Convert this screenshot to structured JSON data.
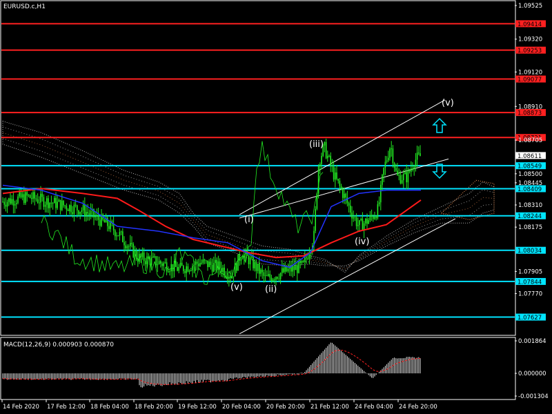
{
  "chart_data": {
    "type": "line",
    "title": "EURUSD.c,H1",
    "symbol": "EURUSD.c",
    "timeframe": "H1",
    "ylim": [
      1.0752,
      1.0955
    ],
    "y_ticks": [
      "1.09525",
      "1.09320",
      "1.09120",
      "1.08910",
      "1.08705",
      "1.08500",
      "1.08445",
      "1.08310",
      "1.08175",
      "1.07905",
      "1.07770"
    ],
    "x_ticks": [
      "14 Feb 2020",
      "17 Feb 12:00",
      "18 Feb 04:00",
      "18 Feb 20:00",
      "19 Feb 12:00",
      "20 Feb 04:00",
      "20 Feb 20:00",
      "21 Feb 12:00",
      "24 Feb 04:00",
      "24 Feb 20:00"
    ],
    "current_price": "1.08611",
    "resistance_levels": [
      {
        "label": "1.09414",
        "value": 1.09414,
        "color": "#ff2020"
      },
      {
        "label": "1.09253",
        "value": 1.09253,
        "color": "#ff2020"
      },
      {
        "label": "1.09077",
        "value": 1.09077,
        "color": "#ff2020"
      },
      {
        "label": "1.08873",
        "value": 1.08873,
        "color": "#ff2020"
      },
      {
        "label": "1.08721",
        "value": 1.08721,
        "color": "#ff2020"
      }
    ],
    "support_levels": [
      {
        "label": "1.08549",
        "value": 1.08549,
        "color": "#00e5ff"
      },
      {
        "label": "1.08409",
        "value": 1.08409,
        "color": "#00e5ff"
      },
      {
        "label": "1.08244",
        "value": 1.08244,
        "color": "#00e5ff"
      },
      {
        "label": "1.08034",
        "value": 1.08034,
        "color": "#00e5ff"
      },
      {
        "label": "1.07844",
        "value": 1.07844,
        "color": "#00e5ff"
      },
      {
        "label": "1.07627",
        "value": 1.07627,
        "color": "#00e5ff"
      }
    ],
    "wave_labels": [
      "(v)",
      "(i)",
      "(ii)",
      "(iii)",
      "(iv)",
      "(v)"
    ],
    "macd": {
      "label": "MACD(12,26,9) 0.000903 0.000870",
      "ylim": [
        -0.001304,
        0.001864
      ],
      "y_ticks": [
        "0.001864",
        "0.000000",
        "-0.001304"
      ]
    }
  },
  "colors": {
    "background": "#000000",
    "candle": "#22ee22",
    "resistance": "#ff2020",
    "support": "#00e5ff",
    "ma_red": "#ff1a1a",
    "ma_blue": "#2233ff",
    "cloud": "#f0f0f0",
    "cloud_orange": "#ff9a5a",
    "channel": "#ffffff",
    "arrow": "#00e5ff"
  }
}
